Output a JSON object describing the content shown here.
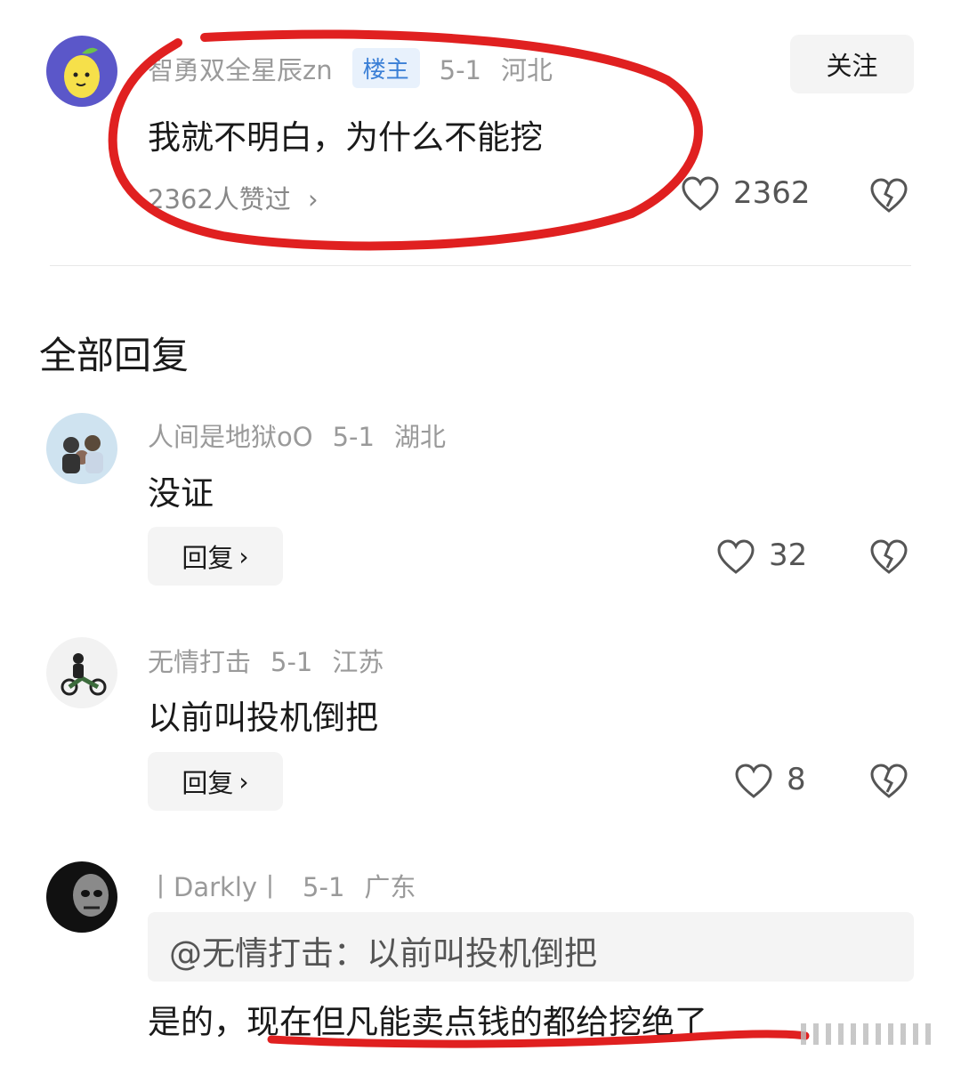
{
  "main_comment": {
    "username": "智勇双全星辰zn",
    "badge": "楼主",
    "date": "5-1",
    "location": "河北",
    "follow_label": "关注",
    "text": "我就不明白，为什么不能挖",
    "likers_text": "2362人赞过",
    "like_count": "2362"
  },
  "section_title": "全部回复",
  "replies": [
    {
      "username": "人间是地狱oO",
      "date": "5-1",
      "location": "湖北",
      "text": "没证",
      "reply_label": "回复",
      "like_count": "32"
    },
    {
      "username": "无情打击",
      "date": "5-1",
      "location": "江苏",
      "text": "以前叫投机倒把",
      "reply_label": "回复",
      "like_count": "8"
    },
    {
      "username": "丨Darkly丨",
      "date": "5-1",
      "location": "广东",
      "quote": "@无情打击：以前叫投机倒把",
      "text": "是的，现在但凡能卖点钱的都给挖绝了"
    }
  ],
  "colors": {
    "annotation_red": "#e02020",
    "badge_blue": "#3a7fd6",
    "meta_gray": "#9a9a9a"
  }
}
